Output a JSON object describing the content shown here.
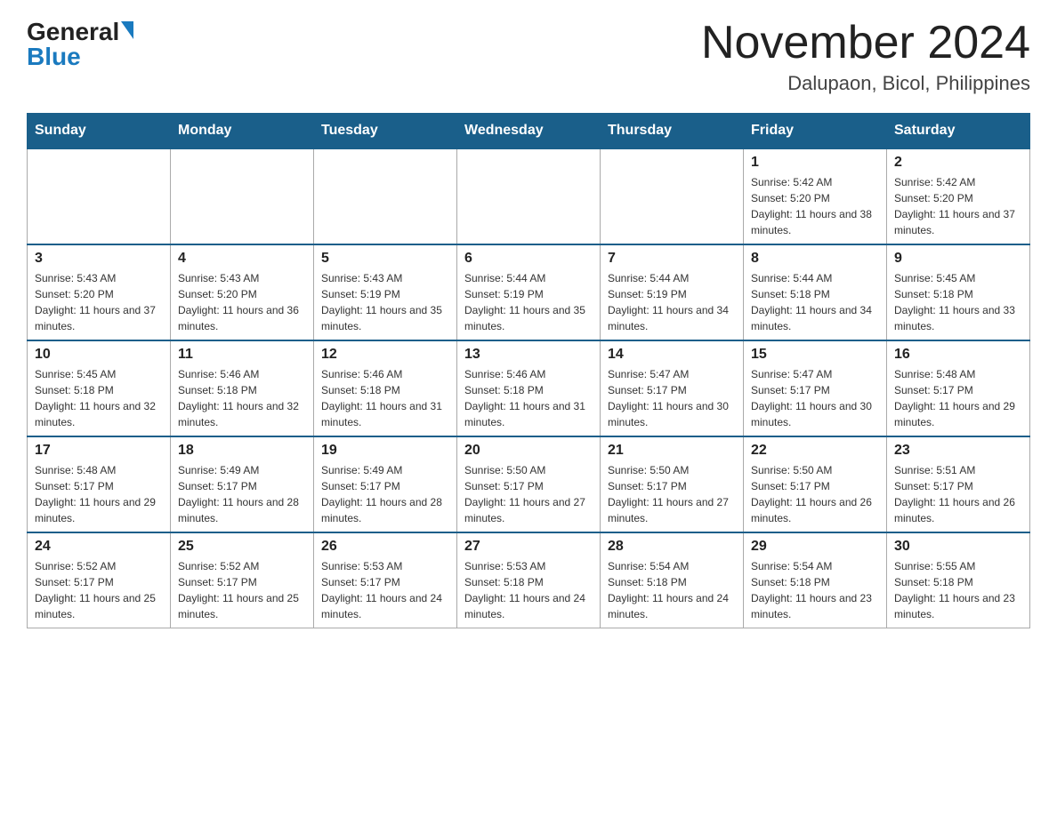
{
  "header": {
    "logo_general": "General",
    "logo_blue": "Blue",
    "month_title": "November 2024",
    "subtitle": "Dalupaon, Bicol, Philippines"
  },
  "calendar": {
    "days_of_week": [
      "Sunday",
      "Monday",
      "Tuesday",
      "Wednesday",
      "Thursday",
      "Friday",
      "Saturday"
    ],
    "weeks": [
      [
        {
          "day": "",
          "info": ""
        },
        {
          "day": "",
          "info": ""
        },
        {
          "day": "",
          "info": ""
        },
        {
          "day": "",
          "info": ""
        },
        {
          "day": "",
          "info": ""
        },
        {
          "day": "1",
          "info": "Sunrise: 5:42 AM\nSunset: 5:20 PM\nDaylight: 11 hours and 38 minutes."
        },
        {
          "day": "2",
          "info": "Sunrise: 5:42 AM\nSunset: 5:20 PM\nDaylight: 11 hours and 37 minutes."
        }
      ],
      [
        {
          "day": "3",
          "info": "Sunrise: 5:43 AM\nSunset: 5:20 PM\nDaylight: 11 hours and 37 minutes."
        },
        {
          "day": "4",
          "info": "Sunrise: 5:43 AM\nSunset: 5:20 PM\nDaylight: 11 hours and 36 minutes."
        },
        {
          "day": "5",
          "info": "Sunrise: 5:43 AM\nSunset: 5:19 PM\nDaylight: 11 hours and 35 minutes."
        },
        {
          "day": "6",
          "info": "Sunrise: 5:44 AM\nSunset: 5:19 PM\nDaylight: 11 hours and 35 minutes."
        },
        {
          "day": "7",
          "info": "Sunrise: 5:44 AM\nSunset: 5:19 PM\nDaylight: 11 hours and 34 minutes."
        },
        {
          "day": "8",
          "info": "Sunrise: 5:44 AM\nSunset: 5:18 PM\nDaylight: 11 hours and 34 minutes."
        },
        {
          "day": "9",
          "info": "Sunrise: 5:45 AM\nSunset: 5:18 PM\nDaylight: 11 hours and 33 minutes."
        }
      ],
      [
        {
          "day": "10",
          "info": "Sunrise: 5:45 AM\nSunset: 5:18 PM\nDaylight: 11 hours and 32 minutes."
        },
        {
          "day": "11",
          "info": "Sunrise: 5:46 AM\nSunset: 5:18 PM\nDaylight: 11 hours and 32 minutes."
        },
        {
          "day": "12",
          "info": "Sunrise: 5:46 AM\nSunset: 5:18 PM\nDaylight: 11 hours and 31 minutes."
        },
        {
          "day": "13",
          "info": "Sunrise: 5:46 AM\nSunset: 5:18 PM\nDaylight: 11 hours and 31 minutes."
        },
        {
          "day": "14",
          "info": "Sunrise: 5:47 AM\nSunset: 5:17 PM\nDaylight: 11 hours and 30 minutes."
        },
        {
          "day": "15",
          "info": "Sunrise: 5:47 AM\nSunset: 5:17 PM\nDaylight: 11 hours and 30 minutes."
        },
        {
          "day": "16",
          "info": "Sunrise: 5:48 AM\nSunset: 5:17 PM\nDaylight: 11 hours and 29 minutes."
        }
      ],
      [
        {
          "day": "17",
          "info": "Sunrise: 5:48 AM\nSunset: 5:17 PM\nDaylight: 11 hours and 29 minutes."
        },
        {
          "day": "18",
          "info": "Sunrise: 5:49 AM\nSunset: 5:17 PM\nDaylight: 11 hours and 28 minutes."
        },
        {
          "day": "19",
          "info": "Sunrise: 5:49 AM\nSunset: 5:17 PM\nDaylight: 11 hours and 28 minutes."
        },
        {
          "day": "20",
          "info": "Sunrise: 5:50 AM\nSunset: 5:17 PM\nDaylight: 11 hours and 27 minutes."
        },
        {
          "day": "21",
          "info": "Sunrise: 5:50 AM\nSunset: 5:17 PM\nDaylight: 11 hours and 27 minutes."
        },
        {
          "day": "22",
          "info": "Sunrise: 5:50 AM\nSunset: 5:17 PM\nDaylight: 11 hours and 26 minutes."
        },
        {
          "day": "23",
          "info": "Sunrise: 5:51 AM\nSunset: 5:17 PM\nDaylight: 11 hours and 26 minutes."
        }
      ],
      [
        {
          "day": "24",
          "info": "Sunrise: 5:52 AM\nSunset: 5:17 PM\nDaylight: 11 hours and 25 minutes."
        },
        {
          "day": "25",
          "info": "Sunrise: 5:52 AM\nSunset: 5:17 PM\nDaylight: 11 hours and 25 minutes."
        },
        {
          "day": "26",
          "info": "Sunrise: 5:53 AM\nSunset: 5:17 PM\nDaylight: 11 hours and 24 minutes."
        },
        {
          "day": "27",
          "info": "Sunrise: 5:53 AM\nSunset: 5:18 PM\nDaylight: 11 hours and 24 minutes."
        },
        {
          "day": "28",
          "info": "Sunrise: 5:54 AM\nSunset: 5:18 PM\nDaylight: 11 hours and 24 minutes."
        },
        {
          "day": "29",
          "info": "Sunrise: 5:54 AM\nSunset: 5:18 PM\nDaylight: 11 hours and 23 minutes."
        },
        {
          "day": "30",
          "info": "Sunrise: 5:55 AM\nSunset: 5:18 PM\nDaylight: 11 hours and 23 minutes."
        }
      ]
    ]
  }
}
